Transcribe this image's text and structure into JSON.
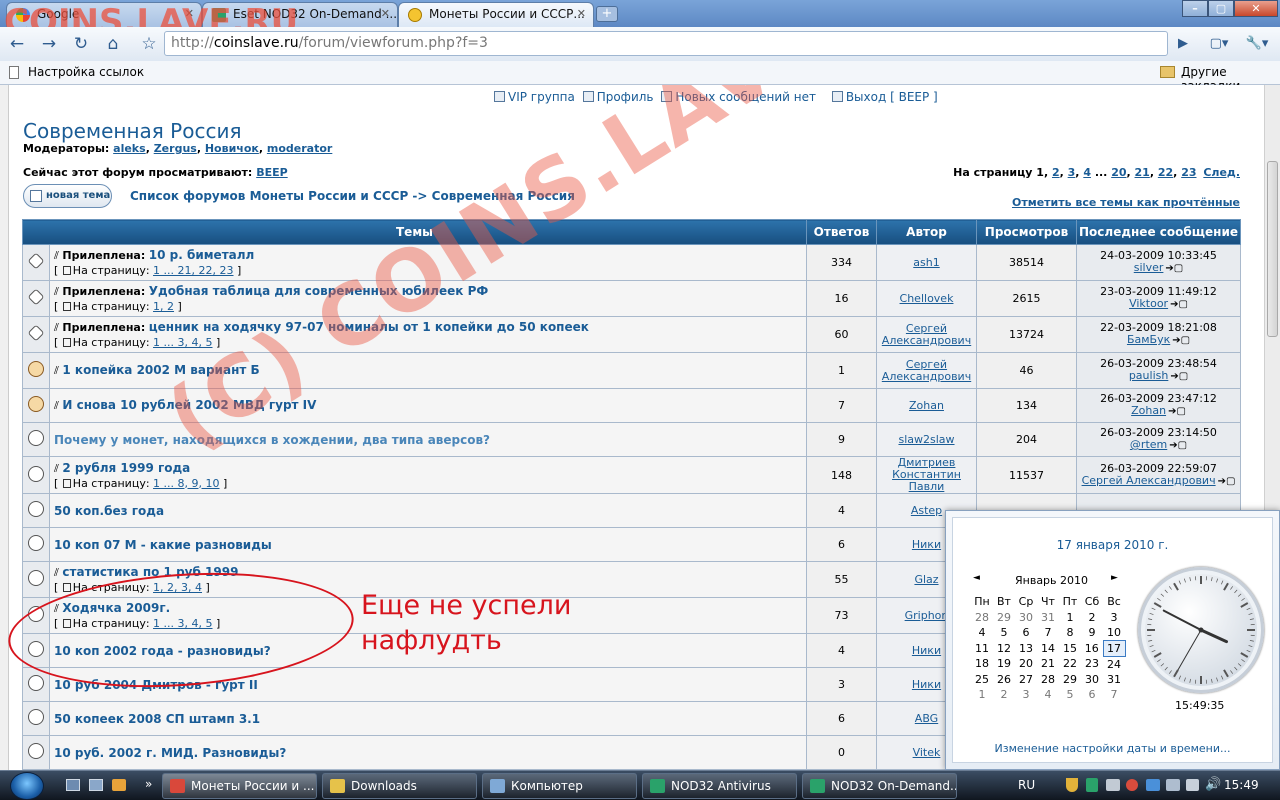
{
  "watermark_top": "COINS.LAVE.RU",
  "watermark_diag": "(C) COINS.LAVE.RU",
  "tabs": [
    {
      "label": "Google"
    },
    {
      "label": "Eset NOD32 On-Demand ..."
    },
    {
      "label": "Монеты России и СССР..."
    }
  ],
  "window_buttons": {
    "min": "–",
    "max": "▢",
    "close": "✕"
  },
  "toolbar": {
    "back": "←",
    "forward": "→",
    "reload": "↻",
    "home": "⌂",
    "star": "☆",
    "url_scheme": "http://",
    "url_host": "coinslave.ru",
    "url_path": "/forum/viewforum.php?f=3",
    "go": "▶",
    "page_menu": "▢▾",
    "tools_menu": "🔧▾"
  },
  "bookmarks": {
    "left": "Настройка ссылок",
    "right": "Другие закладки"
  },
  "toplinks": {
    "vip": "VIP группа",
    "profile": "Профиль",
    "new_posts": "Новых сообщений нет",
    "logout": "Выход [ BEEP ]"
  },
  "forum": {
    "title": "Современная Россия",
    "moderators_label": "Модераторы:",
    "moderators": [
      "aleks",
      "Zergus",
      "Новичок",
      "moderator"
    ],
    "viewing_label": "Сейчас этот форум просматривают:",
    "viewing_user": "BEEP",
    "pages_label": "На страницу",
    "pages_current": "1",
    "pages": [
      "2",
      "3",
      "4",
      "...",
      "20",
      "21",
      "22",
      "23"
    ],
    "pages_next": "След.",
    "new_topic": "новая тема",
    "crumb_root": "Список форумов Монеты России и СССР",
    "crumb_sep": "->",
    "crumb_current": "Современная Россия",
    "mark_read": "Отметить все темы как прочтённые"
  },
  "table": {
    "headers": {
      "topics": "Темы",
      "replies": "Ответов",
      "author": "Автор",
      "views": "Просмотров",
      "last": "Последнее сообщение"
    },
    "sticky_prefix": "Прилеплена:",
    "pages_word": "На страницу:",
    "rows": [
      {
        "icon": "sticky",
        "sticky": true,
        "title": "10 р. биметалл",
        "pages": "1 ... 21, 22, 23",
        "replies": "334",
        "author": "ash1",
        "views": "38514",
        "last_date": "24-03-2009 10:33:45",
        "last_user": "silver"
      },
      {
        "icon": "sticky",
        "sticky": true,
        "title": "Удобная таблица для современных юбилеек РФ",
        "pages": "1, 2",
        "replies": "16",
        "author": "Chellovek",
        "views": "2615",
        "last_date": "23-03-2009 11:49:12",
        "last_user": "Viktoor"
      },
      {
        "icon": "sticky",
        "sticky": true,
        "title": "ценник на ходячку 97-07 номиналы от 1 копейки до 50 копеек",
        "pages": "1 ... 3, 4, 5",
        "replies": "60",
        "author": "Сергей Александрович",
        "views": "13724",
        "last_date": "22-03-2009 18:21:08",
        "last_user": "БамБук"
      },
      {
        "icon": "hot",
        "title": "1 копейка 2002 М вариант Б",
        "replies": "1",
        "author": "Сергей Александрович",
        "views": "46",
        "last_date": "26-03-2009 23:48:54",
        "last_user": "paulish"
      },
      {
        "icon": "hot",
        "title": "И снова 10 рублей 2002 МВД гурт IV",
        "replies": "7",
        "author": "Zohan",
        "views": "134",
        "last_date": "26-03-2009 23:47:12",
        "last_user": "Zohan"
      },
      {
        "icon": "normal",
        "moved": true,
        "title": "Почему у монет, находящихся в хождении, два типа аверсов?",
        "replies": "9",
        "author": "slaw2slaw",
        "views": "204",
        "last_date": "26-03-2009 23:14:50",
        "last_user": "@rtem"
      },
      {
        "icon": "normal",
        "title": "2 рубля 1999 года",
        "pages": "1 ... 8, 9, 10",
        "replies": "148",
        "author": "Дмитриев Константин Павли",
        "views": "11537",
        "last_date": "26-03-2009 22:59:07",
        "last_user": "Сергей Александрович"
      },
      {
        "icon": "normal",
        "title": "50 коп.без года",
        "replies": "4",
        "author": "Astep"
      },
      {
        "icon": "normal",
        "title": "10 коп 07 М - какие разновиды",
        "replies": "6",
        "author": "Ники"
      },
      {
        "icon": "normal",
        "title": "статистика по 1 руб 1999",
        "pages": "1, 2, 3, 4",
        "replies": "55",
        "author": "Glaz"
      },
      {
        "icon": "normal",
        "title": "Ходячка 2009г.",
        "pages": "1 ... 3, 4, 5",
        "replies": "73",
        "author": "Griphon"
      },
      {
        "icon": "normal",
        "title": "10 коп 2002 года - разновиды?",
        "replies": "4",
        "author": "Ники"
      },
      {
        "icon": "normal",
        "title": "10 руб 2004 Дмитров - гурт II",
        "replies": "3",
        "author": "Ники"
      },
      {
        "icon": "normal",
        "title": "50 копеек 2008 СП штамп 3.1",
        "replies": "6",
        "author": "ABG"
      },
      {
        "icon": "normal",
        "title": "10 руб. 2002 г. МИД. Разновиды?",
        "replies": "0",
        "author": "Vitek"
      }
    ]
  },
  "annotation": {
    "line1": "Еще не успели",
    "line2": "нафлудть"
  },
  "calendar": {
    "date_long": "17 января 2010 г.",
    "month": "Январь 2010",
    "prev": "◄",
    "next": "►",
    "weekdays": [
      "Пн",
      "Вт",
      "Ср",
      "Чт",
      "Пт",
      "Сб",
      "Вс"
    ],
    "weeks": [
      [
        "28",
        "29",
        "30",
        "31",
        "1",
        "2",
        "3"
      ],
      [
        "4",
        "5",
        "6",
        "7",
        "8",
        "9",
        "10"
      ],
      [
        "11",
        "12",
        "13",
        "14",
        "15",
        "16",
        "17"
      ],
      [
        "18",
        "19",
        "20",
        "21",
        "22",
        "23",
        "24"
      ],
      [
        "25",
        "26",
        "27",
        "28",
        "29",
        "30",
        "31"
      ],
      [
        "1",
        "2",
        "3",
        "4",
        "5",
        "6",
        "7"
      ]
    ],
    "today": "17",
    "time": "15:49:35",
    "change_link": "Изменение настройки даты и времени..."
  },
  "taskbar": {
    "quick_more": "»",
    "items": [
      {
        "label": "Монеты России и ...",
        "active": true,
        "color": "#d9483b"
      },
      {
        "label": "Downloads",
        "color": "#e6c24a"
      },
      {
        "label": "Компьютер",
        "color": "#7fa9d6"
      },
      {
        "label": "NOD32 Antivirus",
        "color": "#2aa26a"
      },
      {
        "label": "NOD32 On-Demand...",
        "color": "#2aa26a"
      }
    ],
    "lang": "RU",
    "time": "15:49"
  }
}
